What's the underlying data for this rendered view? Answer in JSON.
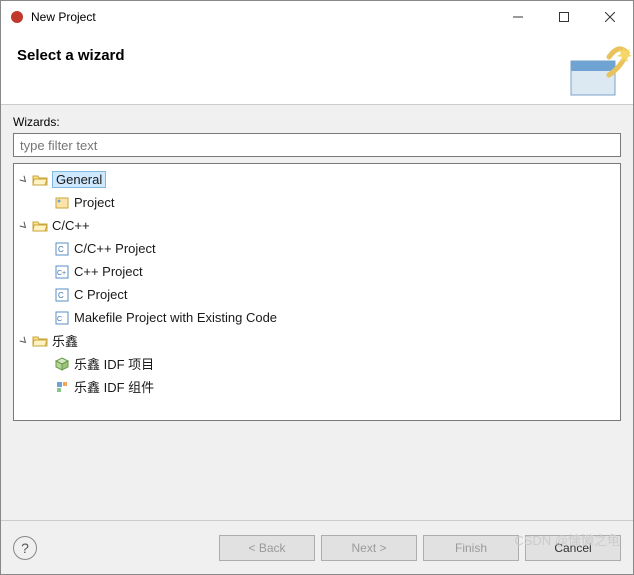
{
  "window": {
    "title": "New Project"
  },
  "banner": {
    "title": "Select a wizard"
  },
  "content": {
    "wizards_label": "Wizards:",
    "filter_placeholder": "type filter text"
  },
  "tree": {
    "general": {
      "label": "General"
    },
    "general_project": {
      "label": "Project"
    },
    "ccpp": {
      "label": "C/C++"
    },
    "ccpp_project": {
      "label": "C/C++ Project"
    },
    "cpp_project": {
      "label": "C++ Project"
    },
    "c_project": {
      "label": "C Project"
    },
    "makefile": {
      "label": "Makefile Project with Existing Code"
    },
    "lexin": {
      "label": "乐鑫"
    },
    "lexin_idf_proj": {
      "label": "乐鑫 IDF 项目"
    },
    "lexin_idf_comp": {
      "label": "乐鑫 IDF 组件"
    }
  },
  "footer": {
    "back": "< Back",
    "next": "Next >",
    "finish": "Finish",
    "cancel": "Cancel"
  },
  "watermark": "CSDN @慵懒之龟"
}
